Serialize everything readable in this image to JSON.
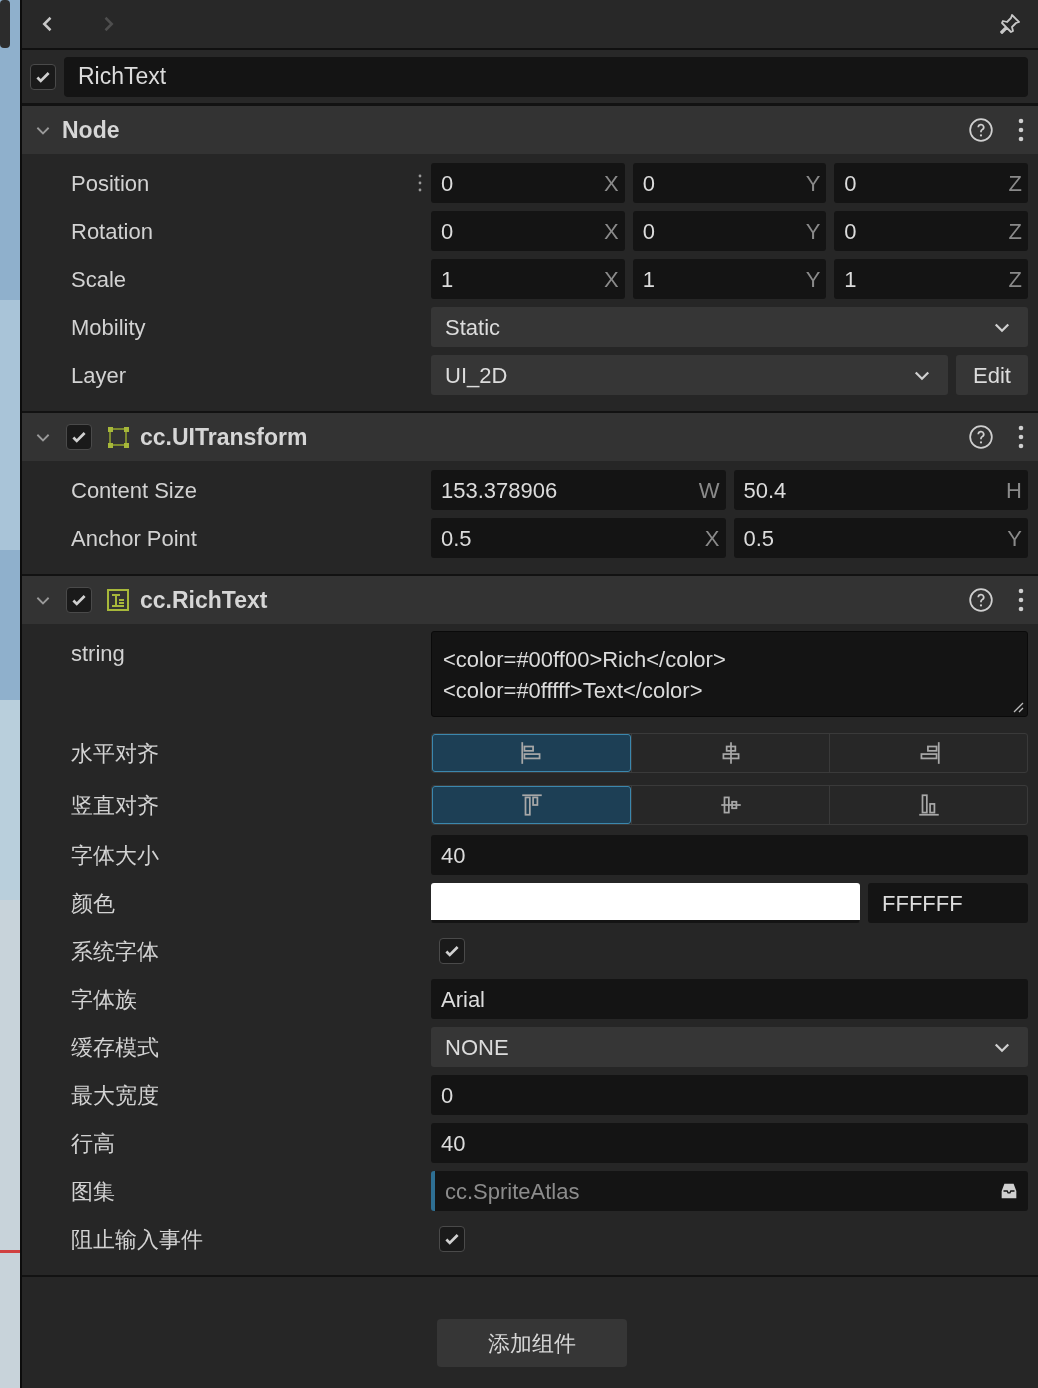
{
  "nav": {
    "back_enabled": true,
    "forward_enabled": false
  },
  "node_name": {
    "value": "RichText",
    "checked": true
  },
  "sections": [
    {
      "kind": "node",
      "title": "Node",
      "expanded": true,
      "rows": [
        {
          "kind": "vector",
          "label": "Position",
          "handle": true,
          "fields": [
            {
              "value": "0",
              "axis": "X"
            },
            {
              "value": "0",
              "axis": "Y"
            },
            {
              "value": "0",
              "axis": "Z"
            }
          ]
        },
        {
          "kind": "vector",
          "label": "Rotation",
          "handle": false,
          "fields": [
            {
              "value": "0",
              "axis": "X"
            },
            {
              "value": "0",
              "axis": "Y"
            },
            {
              "value": "0",
              "axis": "Z"
            }
          ]
        },
        {
          "kind": "vector",
          "label": "Scale",
          "handle": false,
          "fields": [
            {
              "value": "1",
              "axis": "X"
            },
            {
              "value": "1",
              "axis": "Y"
            },
            {
              "value": "1",
              "axis": "Z"
            }
          ]
        },
        {
          "kind": "select",
          "label": "Mobility",
          "value": "Static"
        },
        {
          "kind": "select",
          "label": "Layer",
          "value": "UI_2D",
          "button": "Edit"
        }
      ]
    },
    {
      "kind": "ui_transform",
      "title": "cc.UITransform",
      "expanded": true,
      "checked": true,
      "rows": [
        {
          "kind": "vector",
          "label": "Content Size",
          "handle": false,
          "fields": [
            {
              "value": "153.378906",
              "axis": "W"
            },
            {
              "value": "50.4",
              "axis": "H"
            }
          ]
        },
        {
          "kind": "vector",
          "label": "Anchor Point",
          "handle": false,
          "fields": [
            {
              "value": "0.5",
              "axis": "X"
            },
            {
              "value": "0.5",
              "axis": "Y"
            }
          ]
        }
      ]
    },
    {
      "kind": "rich_text",
      "title": "cc.RichText",
      "expanded": true,
      "checked": true,
      "rows": [
        {
          "kind": "textarea",
          "label": "string",
          "value": "<color=#00ff00>Rich</color>\n<color=#0fffff>Text</color>"
        },
        {
          "kind": "align_h",
          "label": "水平对齐",
          "options": [
            {
              "selected": true
            },
            {
              "selected": false
            },
            {
              "selected": false
            }
          ]
        },
        {
          "kind": "align_v",
          "label": "竖直对齐",
          "options": [
            {
              "selected": true
            },
            {
              "selected": false
            },
            {
              "selected": false
            }
          ]
        },
        {
          "kind": "input",
          "label": "字体大小",
          "value": "40"
        },
        {
          "kind": "color",
          "label": "颜色",
          "color": "#ffffff",
          "hex": "FFFFFF"
        },
        {
          "kind": "checkbox",
          "label": "系统字体",
          "checked": true
        },
        {
          "kind": "input",
          "label": "字体族",
          "value": "Arial"
        },
        {
          "kind": "select",
          "label": "缓存模式",
          "value": "NONE"
        },
        {
          "kind": "input",
          "label": "最大宽度",
          "value": "0"
        },
        {
          "kind": "input",
          "label": "行高",
          "value": "40"
        },
        {
          "kind": "asset",
          "label": "图集",
          "placeholder": "cc.SpriteAtlas"
        },
        {
          "kind": "checkbox",
          "label": "阻止输入事件",
          "checked": true
        }
      ]
    }
  ],
  "add_button": "添加组件"
}
